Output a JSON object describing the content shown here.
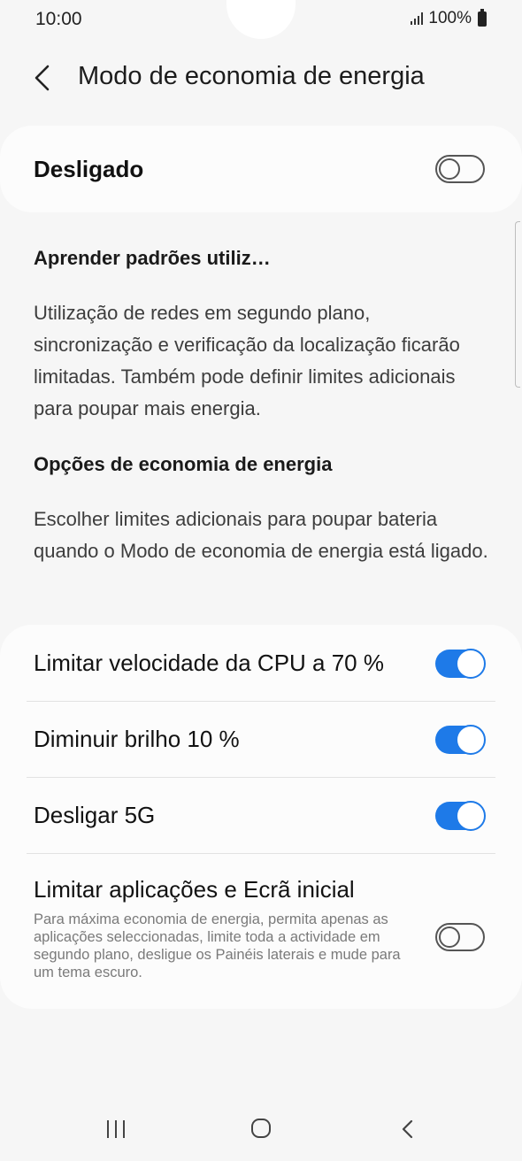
{
  "status": {
    "time": "10:00",
    "battery": "100%"
  },
  "header": {
    "title": "Modo de economia de energia"
  },
  "master": {
    "label": "Desligado",
    "enabled": false
  },
  "learn": {
    "title": "Aprender padrões utiliz…",
    "description": "Utilização de redes em segundo plano, sincronização e verificação da localização ficarão limitadas. Também pode definir limites adicionais para poupar mais energia."
  },
  "options_info": {
    "title": "Opções de economia de energia",
    "description": "Escolher limites adicionais para poupar bateria quando o Modo de economia de energia está ligado."
  },
  "options": [
    {
      "label": "Limitar velocidade da CPU a 70 %",
      "enabled": true
    },
    {
      "label": "Diminuir brilho 10 %",
      "enabled": true
    },
    {
      "label": "Desligar 5G",
      "enabled": true
    },
    {
      "label": "Limitar aplicações e Ecrã inicial",
      "enabled": false,
      "description": "Para máxima economia de energia, permita apenas as aplicações seleccionadas, limite toda a actividade em segundo plano, desligue os Painéis laterais e mude para um tema escuro."
    }
  ],
  "icons": {
    "back": "chevron-left-icon",
    "recent": "recent-apps-icon",
    "home": "home-icon",
    "nav_back": "back-icon"
  },
  "colors": {
    "accent": "#1e7ae8",
    "background": "#f6f6f6",
    "card": "#fcfcfc"
  }
}
